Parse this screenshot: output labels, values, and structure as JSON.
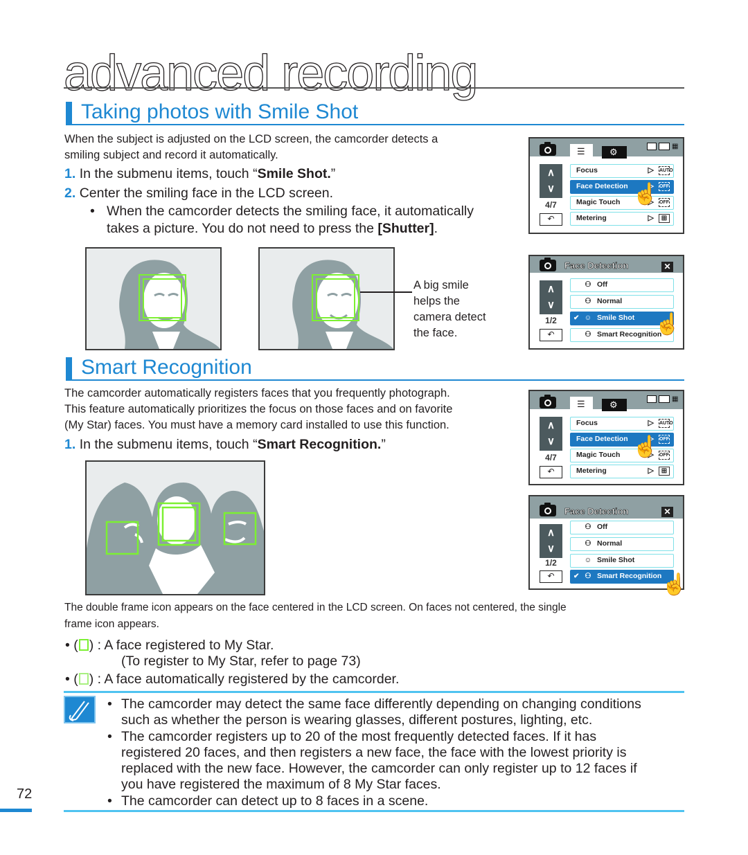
{
  "page": {
    "chapter_title": "advanced recording",
    "page_number": "72"
  },
  "smile_shot": {
    "heading": "Taking photos with Smile Shot",
    "intro_line1": "When the subject is adjusted on the LCD screen, the camcorder detects a",
    "intro_line2": "smiling subject and record it automatically.",
    "steps": [
      {
        "num": "1.",
        "pre": "In the submenu items, touch “",
        "bold": "Smile Shot.",
        "post": "”"
      },
      {
        "num": "2.",
        "pre": "Center the smiling face in the LCD screen.",
        "bold": "",
        "post": ""
      }
    ],
    "bullet_line1": "When the camcorder detects the smiling face, it automatically",
    "bullet_pre": "takes a picture. You do not need to press the ",
    "bullet_bold": "[Shutter]",
    "bullet_post": ".",
    "callout": [
      "A big smile",
      "helps the",
      "camera detect",
      "the face."
    ]
  },
  "smart_recognition": {
    "heading": "Smart Recognition",
    "intro": [
      "The camcorder automatically registers faces that you frequently photograph.",
      "This feature automatically prioritizes the focus on those faces and on favorite",
      "(My Star) faces. You must have a memory card installed to use this function."
    ],
    "step": {
      "num": "1.",
      "pre": "In the submenu items, touch “",
      "bold": "Smart Recognition.",
      "post": "”"
    },
    "frame_note": [
      "The double frame icon appears on the face centered in the LCD screen. On faces not centered, the single",
      "frame icon appears."
    ],
    "legend": [
      {
        "text": " : A face registered to My Star.",
        "sub": "(To register to My Star, refer to page 73)"
      },
      {
        "text": " : A face automatically registered by the camcorder.",
        "sub": ""
      }
    ]
  },
  "notes": [
    [
      "The camcorder may detect the same face differently depending on changing conditions",
      "such as whether the person is wearing glasses, different postures, lighting, etc."
    ],
    [
      "The camcorder registers up to 20 of the most frequently detected faces. If it has",
      "registered 20 faces, and then registers a new face, the face with the lowest priority is",
      "replaced with the new face. However, the camcorder can only register up to 12 faces if",
      "you have registered the maximum of 8 My Star faces."
    ],
    [
      "The camcorder can detect up to 8 faces in a scene."
    ]
  ],
  "lcd_menu": {
    "page_indicator": "4/7",
    "items": [
      {
        "label": "Focus",
        "icon": "AUTO"
      },
      {
        "label": "Face Detection",
        "icon": "OFF"
      },
      {
        "label": "Magic Touch",
        "icon": "OFF"
      },
      {
        "label": "Metering",
        "icon": "grid"
      }
    ],
    "selected_index": 1,
    "status": {
      "card": "card",
      "battery": "battery",
      "remaining": "min"
    }
  },
  "lcd_face_detection": {
    "title": "Face Detection",
    "page_indicator": "1/2",
    "items": [
      "Off",
      "Normal",
      "Smile Shot",
      "Smart Recognition"
    ],
    "selected_screen1": 2,
    "selected_screen2": 3,
    "check_mark": "✔",
    "close": "✕"
  },
  "glyphs": {
    "up": "∧",
    "down": "∨",
    "back": "↶",
    "play": "▷",
    "hand": "☝",
    "menu_tab": "☰",
    "gear_tab": "⚙",
    "smile": "☺"
  },
  "colors": {
    "accent_blue": "#1e88d2",
    "note_rule": "#4fc3f0",
    "face_frame_green": "#7cf032",
    "lcd_header": "#8fa0a3",
    "lcd_selected": "#1d78c1",
    "lcd_item_border": "#7fe0e8"
  }
}
